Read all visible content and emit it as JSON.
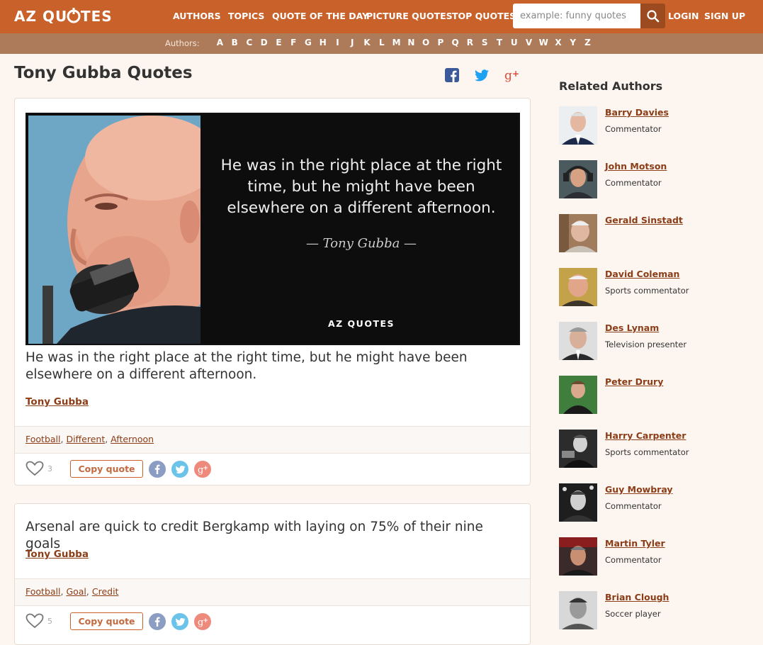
{
  "header": {
    "logo": "AZ QUOTES",
    "nav": [
      "AUTHORS",
      "TOPICS",
      "QUOTE OF THE DAY",
      "PICTURE QUOTES",
      "TOP QUOTES"
    ],
    "search_placeholder": "example: funny quotes",
    "login": "LOGIN",
    "signup": "SIGN UP",
    "brand_color": "#c8622a"
  },
  "alphabet": {
    "label": "Authors:",
    "letters": [
      "A",
      "B",
      "C",
      "D",
      "E",
      "F",
      "G",
      "H",
      "I",
      "J",
      "K",
      "L",
      "M",
      "N",
      "O",
      "P",
      "Q",
      "R",
      "S",
      "T",
      "U",
      "V",
      "W",
      "X",
      "Y",
      "Z"
    ]
  },
  "page": {
    "title": "Tony Gubba Quotes"
  },
  "quotes": [
    {
      "image_text": "He was in the right place at the right time, but he might have been elsewhere on a different afternoon.",
      "image_author": "— Tony Gubba —",
      "image_logo": "AZ QUOTES",
      "text": "He was in the right place at the right time, but he might have been elsewhere on a different afternoon.",
      "author": "Tony Gubba",
      "tags": [
        "Football",
        "Different",
        "Afternoon"
      ],
      "likes": "3",
      "copy_label": "Copy quote"
    },
    {
      "text": "Arsenal are quick to credit Bergkamp with laying on 75% of their nine goals",
      "author": "Tony Gubba",
      "tags": [
        "Football",
        "Goal",
        "Credit"
      ],
      "likes": "5",
      "copy_label": "Copy quote"
    }
  ],
  "sidebar": {
    "title": "Related Authors",
    "authors": [
      {
        "name": "Barry Davies",
        "profession": "Commentator"
      },
      {
        "name": "John Motson",
        "profession": "Commentator"
      },
      {
        "name": "Gerald Sinstadt",
        "profession": ""
      },
      {
        "name": "David Coleman",
        "profession": "Sports commentator"
      },
      {
        "name": "Des Lynam",
        "profession": "Television presenter"
      },
      {
        "name": "Peter Drury",
        "profession": ""
      },
      {
        "name": "Harry Carpenter",
        "profession": "Sports commentator"
      },
      {
        "name": "Guy Mowbray",
        "profession": "Commentator"
      },
      {
        "name": "Martin Tyler",
        "profession": "Commentator"
      },
      {
        "name": "Brian Clough",
        "profession": "Soccer player"
      }
    ]
  }
}
